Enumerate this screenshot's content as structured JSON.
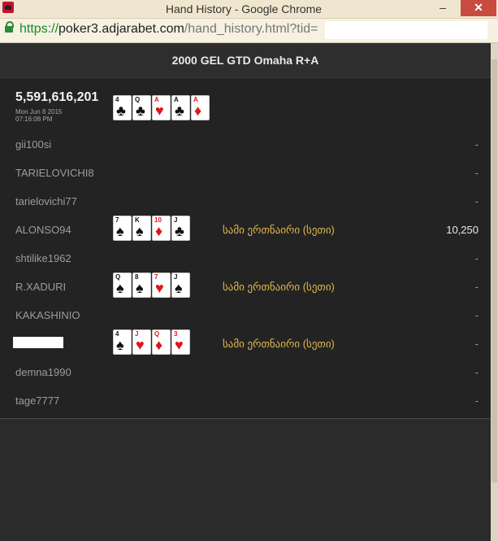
{
  "window": {
    "title": "Hand History - Google Chrome",
    "url_scheme": "https://",
    "url_host": "poker3.adjarabet.com",
    "url_path": "/hand_history.html?tid="
  },
  "header": {
    "title": "2000 GEL GTD Omaha R+A"
  },
  "hand": {
    "id": "5,591,616,201",
    "date": "Mon Jun 8 2015",
    "time": "07:16:08 PM",
    "board": [
      {
        "rank": "4",
        "suit": "♣",
        "color": "black"
      },
      {
        "rank": "Q",
        "suit": "♣",
        "color": "black"
      },
      {
        "rank": "A",
        "suit": "♥",
        "color": "red"
      },
      {
        "rank": "A",
        "suit": "♣",
        "color": "black"
      },
      {
        "rank": "A",
        "suit": "♦",
        "color": "red"
      }
    ]
  },
  "players": [
    {
      "name": "gii100si",
      "combo": "",
      "win": "-",
      "cards": []
    },
    {
      "name": "TARIELOVICHI8",
      "combo": "",
      "win": "-",
      "cards": []
    },
    {
      "name": "tarielovichi77",
      "combo": "",
      "win": "-",
      "cards": []
    },
    {
      "name": "ALONSO94",
      "combo": "სამი ერთნაირი (სეთი)",
      "win": "10,250",
      "cards": [
        {
          "rank": "7",
          "suit": "♠",
          "color": "black"
        },
        {
          "rank": "K",
          "suit": "♠",
          "color": "black"
        },
        {
          "rank": "10",
          "suit": "♦",
          "color": "red"
        },
        {
          "rank": "J",
          "suit": "♣",
          "color": "black"
        }
      ]
    },
    {
      "name": "shtilike1962",
      "combo": "",
      "win": "-",
      "cards": []
    },
    {
      "name": "R.XADURI",
      "combo": "სამი ერთნაირი (სეთი)",
      "win": "-",
      "cards": [
        {
          "rank": "Q",
          "suit": "♠",
          "color": "black"
        },
        {
          "rank": "8",
          "suit": "♠",
          "color": "black"
        },
        {
          "rank": "7",
          "suit": "♥",
          "color": "red"
        },
        {
          "rank": "J",
          "suit": "♠",
          "color": "black"
        }
      ]
    },
    {
      "name": "KAKASHINIO",
      "combo": "",
      "win": "-",
      "cards": []
    },
    {
      "name": "",
      "masked": true,
      "combo": "სამი ერთნაირი (სეთი)",
      "win": "-",
      "cards": [
        {
          "rank": "4",
          "suit": "♠",
          "color": "black"
        },
        {
          "rank": "J",
          "suit": "♥",
          "color": "red"
        },
        {
          "rank": "Q",
          "suit": "♦",
          "color": "red"
        },
        {
          "rank": "3",
          "suit": "♥",
          "color": "red"
        }
      ]
    },
    {
      "name": "demna1990",
      "combo": "",
      "win": "-",
      "cards": []
    },
    {
      "name": "tage7777",
      "combo": "",
      "win": "-",
      "cards": []
    }
  ],
  "colors": {
    "combo_text": "#e3b84a",
    "player_name": "#9c9c9c",
    "card_red": "#e0151b",
    "card_black": "#111111"
  }
}
